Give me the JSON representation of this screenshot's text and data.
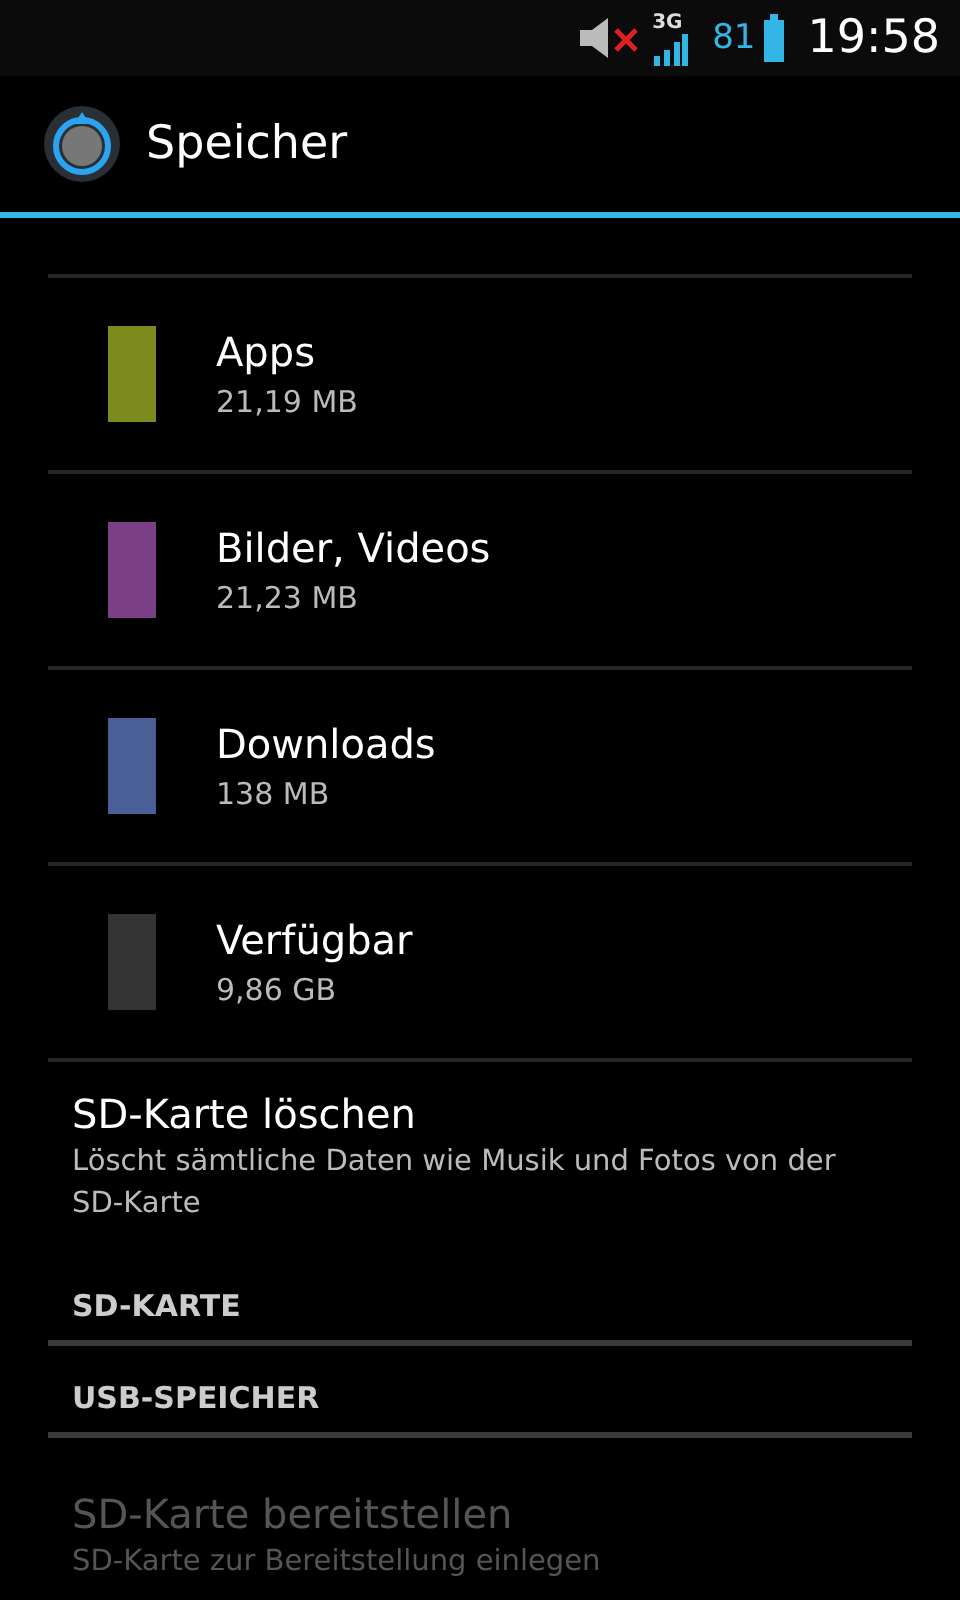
{
  "status_bar": {
    "battery_percent": "81",
    "network": "3G",
    "time": "19:58"
  },
  "action_bar": {
    "title": "Speicher"
  },
  "categories": [
    {
      "label": "Apps",
      "size": "21,19 MB",
      "color": "#7d8a1e"
    },
    {
      "label": "Bilder, Videos",
      "size": "21,23 MB",
      "color": "#7b3f86"
    },
    {
      "label": "Downloads",
      "size": "138 MB",
      "color": "#4a5f96"
    },
    {
      "label": "Verfügbar",
      "size": "9,86 GB",
      "color": "#333333"
    }
  ],
  "items": [
    {
      "kind": "action",
      "title": "SD-Karte löschen",
      "summary": "Löscht sämtliche Daten wie Musik und Fotos von der SD-Karte",
      "disabled": false
    },
    {
      "kind": "header",
      "title": "SD-KARTE"
    },
    {
      "kind": "header",
      "title": "USB-SPEICHER"
    },
    {
      "kind": "action",
      "title": "SD-Karte bereitstellen",
      "summary": "SD-Karte zur Bereitstellung einlegen",
      "disabled": true
    }
  ]
}
